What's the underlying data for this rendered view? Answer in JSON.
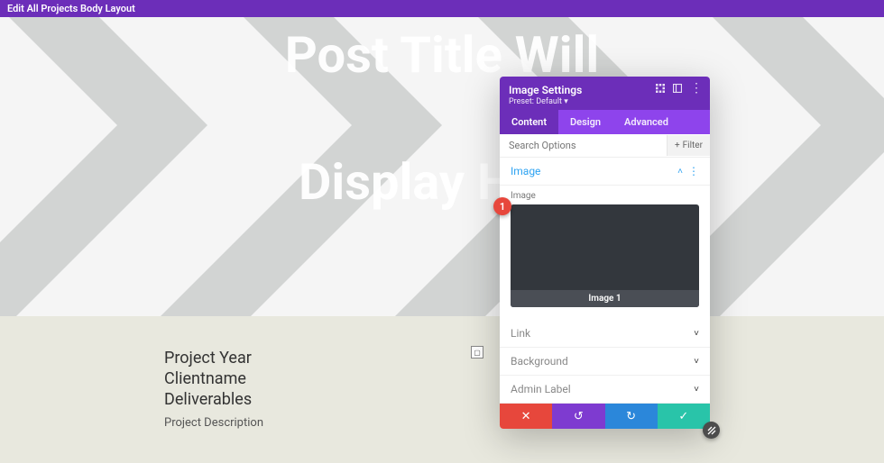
{
  "topBar": {
    "title": "Edit All Projects Body Layout"
  },
  "hero": {
    "line1": "Post Title Will",
    "line2": "Display Here"
  },
  "project": {
    "year": "Project Year",
    "client": "Clientname",
    "deliverables": "Deliverables",
    "description": "Project Description"
  },
  "marker": {
    "num": "1"
  },
  "panel": {
    "title": "Image Settings",
    "presetPrefix": "Preset:",
    "presetValue": "Default",
    "tabs": {
      "content": "Content",
      "design": "Design",
      "advanced": "Advanced"
    },
    "search": {
      "placeholder": "Search Options",
      "filterLabel": "Filter"
    },
    "sections": {
      "image": "Image",
      "link": "Link",
      "background": "Background",
      "adminLabel": "Admin Label"
    },
    "imageField": {
      "label": "Image",
      "boxLabel": "Image 1"
    },
    "footer": {
      "cancel": "✕",
      "undo": "↺",
      "redo": "↻",
      "save": "✓"
    }
  }
}
